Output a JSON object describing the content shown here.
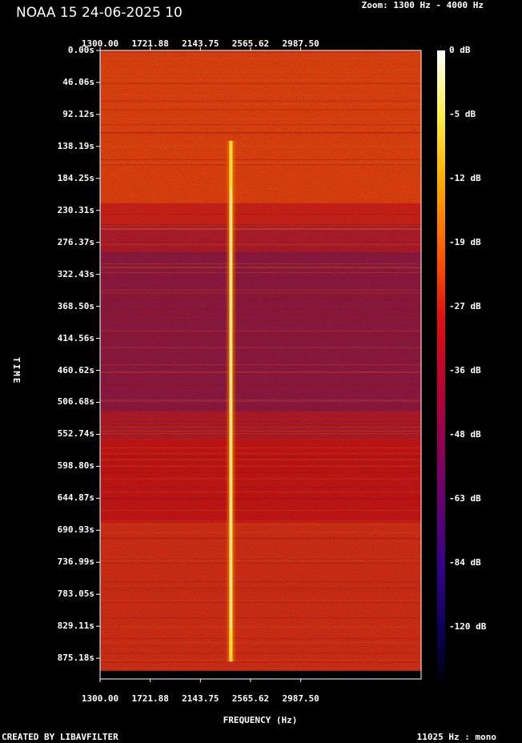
{
  "title": "NOAA 15 24-06-2025 10",
  "zoom_label": "Zoom: 1300 Hz - 4000 Hz",
  "footer_left": "CREATED BY LIBAVFILTER",
  "footer_right": "11025 Hz : mono",
  "chart_data": {
    "type": "heatmap",
    "xlabel": "FREQUENCY (Hz)",
    "ylabel": "TIME",
    "x_ticks": [
      "1300.00",
      "1721.88",
      "2143.75",
      "2565.62",
      "2987.50"
    ],
    "x_tick_values": [
      1300.0,
      1721.88,
      2143.75,
      2565.62,
      2987.5
    ],
    "xlim": [
      1300,
      4000
    ],
    "y_ticks": [
      "0.00s",
      "46.06s",
      "92.12s",
      "138.19s",
      "184.25s",
      "230.31s",
      "276.37s",
      "322.43s",
      "368.50s",
      "414.56s",
      "460.62s",
      "506.68s",
      "552.74s",
      "598.80s",
      "644.87s",
      "690.93s",
      "736.99s",
      "783.05s",
      "829.11s",
      "875.18s"
    ],
    "y_tick_values": [
      0.0,
      46.06,
      92.12,
      138.19,
      184.25,
      230.31,
      276.37,
      322.43,
      368.5,
      414.56,
      460.62,
      506.68,
      552.74,
      598.8,
      644.87,
      690.93,
      736.99,
      783.05,
      829.11,
      875.18
    ],
    "ylim": [
      0,
      905
    ],
    "colorbar_labels": [
      "0 dB",
      "-5 dB",
      "-12 dB",
      "-19 dB",
      "-27 dB",
      "-36 dB",
      "-48 dB",
      "-63 dB",
      "-84 dB",
      "-120 dB"
    ],
    "colorbar_colors": [
      "#ffffff",
      "#fff04a",
      "#ffb000",
      "#ff5a00",
      "#e01010",
      "#b0003a",
      "#6a0070",
      "#30008a",
      "#0a0050",
      "#000000"
    ],
    "signal": {
      "frequency_hz": 2400,
      "time_start_s": 130,
      "time_end_s": 880,
      "color": "#ffe030"
    },
    "background_bands": [
      {
        "from_s": 0,
        "to_s": 220,
        "color": "#ff4a10"
      },
      {
        "from_s": 220,
        "to_s": 250,
        "color": "#e8261a"
      },
      {
        "from_s": 250,
        "to_s": 290,
        "color": "#c82030"
      },
      {
        "from_s": 290,
        "to_s": 520,
        "color": "#a21c4a"
      },
      {
        "from_s": 520,
        "to_s": 560,
        "color": "#c81e2c"
      },
      {
        "from_s": 560,
        "to_s": 680,
        "color": "#e01818"
      },
      {
        "from_s": 680,
        "to_s": 905,
        "color": "#ee3418"
      }
    ]
  }
}
